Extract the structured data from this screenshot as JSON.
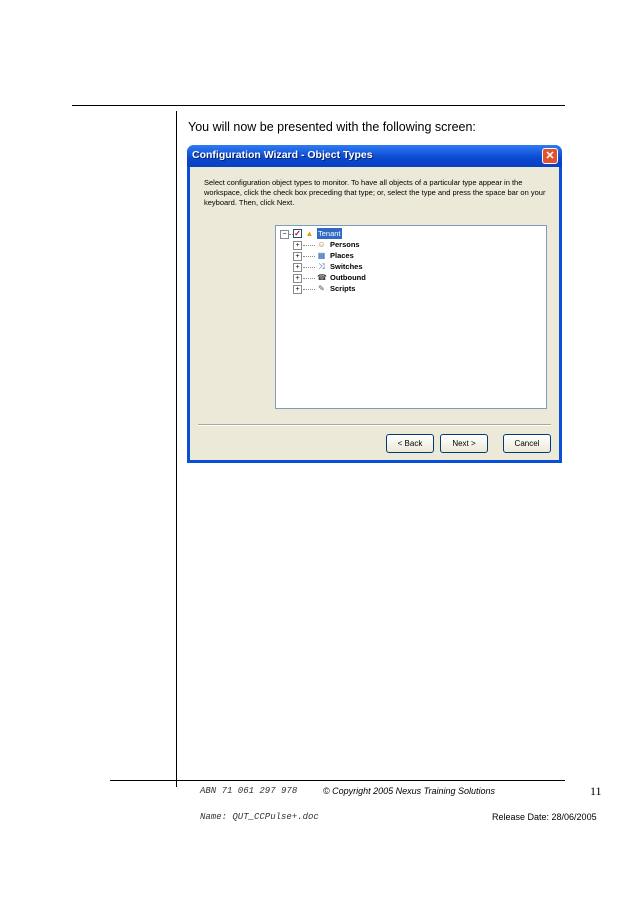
{
  "intro_text": "You will now be presented with the following screen:",
  "dialog": {
    "title": "Configuration Wizard - Object Types",
    "close_glyph": "✕",
    "instructions": "Select configuration object types to monitor. To have all objects of a particular type appear in the workspace, click the check box preceding that type; or, select the type and press the space bar on your keyboard. Then, click Next.",
    "tree": {
      "root": {
        "label": "Tenant",
        "checked": true,
        "icon": "warning-icon"
      },
      "children": [
        {
          "label": "Persons",
          "icon": "person-icon"
        },
        {
          "label": "Places",
          "icon": "place-icon"
        },
        {
          "label": "Switches",
          "icon": "switch-icon"
        },
        {
          "label": "Outbound",
          "icon": "outbound-icon"
        },
        {
          "label": "Scripts",
          "icon": "script-icon"
        }
      ],
      "expand_glyph": "+",
      "collapse_glyph": "−"
    },
    "buttons": {
      "back": "< Back",
      "next": "Next >",
      "cancel": "Cancel"
    }
  },
  "footer": {
    "abn": "ABN 71 061 297 978",
    "copyright": "© Copyright 2005 Nexus Training Solutions",
    "page_number": "11",
    "name": "Name: QUT_CCPulse+.doc",
    "release": "Release Date: 28/06/2005"
  }
}
